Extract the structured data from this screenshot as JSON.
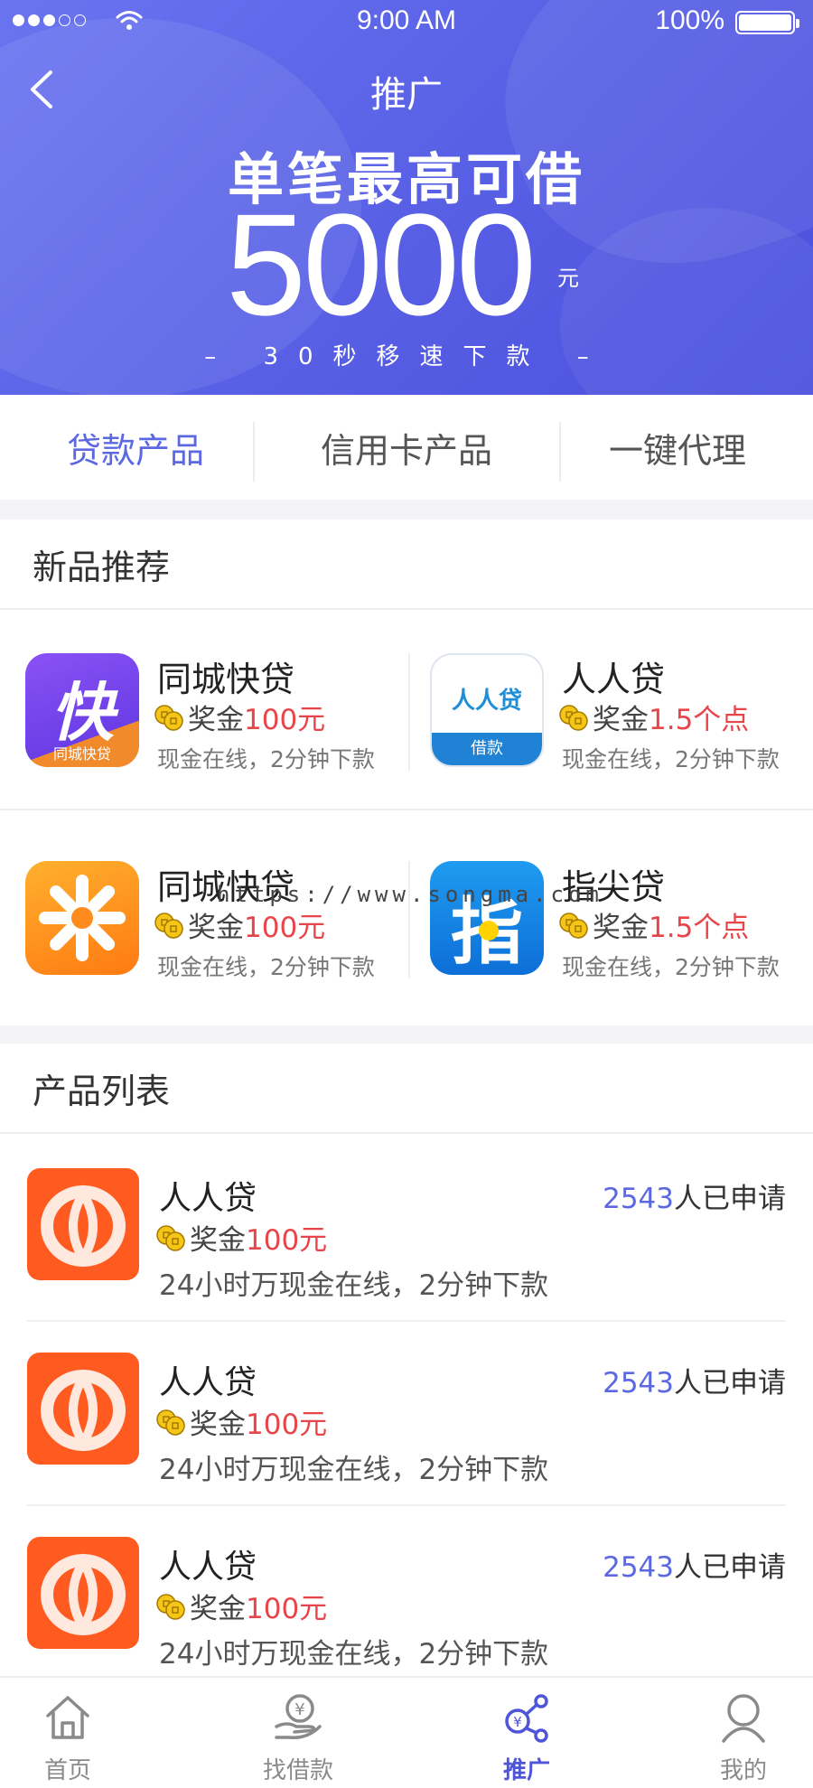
{
  "status_bar": {
    "time": "9:00 AM",
    "battery": "100%"
  },
  "nav": {
    "title": "推广"
  },
  "banner": {
    "headline": "单笔最高可借",
    "amount": "5000",
    "unit": "元",
    "subline": "– 30秒移速下款 –"
  },
  "tabs": [
    {
      "label": "贷款产品",
      "active": true
    },
    {
      "label": "信用卡产品",
      "active": false
    },
    {
      "label": "一键代理",
      "active": false
    }
  ],
  "new_products": {
    "title": "新品推荐",
    "items": [
      {
        "name": "同城快贷",
        "bonus_label": "奖金",
        "bonus_value": "100元",
        "desc": "现金在线，2分钟下款",
        "icon": "kuai-app-icon",
        "icon_text": "快",
        "icon_subtext": "同城快贷"
      },
      {
        "name": "人人贷",
        "bonus_label": "奖金",
        "bonus_value": "1.5个点",
        "desc": "现金在线，2分钟下款",
        "icon": "renrendai-app-icon",
        "icon_text": "人人贷",
        "icon_subtext": "借款"
      },
      {
        "name": "同城快贷",
        "bonus_label": "奖金",
        "bonus_value": "100元",
        "desc": "现金在线，2分钟下款",
        "icon": "star-app-icon"
      },
      {
        "name": "指尖贷",
        "bonus_label": "奖金",
        "bonus_value": "1.5个点",
        "desc": "现金在线，2分钟下款",
        "icon": "zhijian-app-icon",
        "icon_text": "指"
      }
    ]
  },
  "watermark": "https://www.songma.com",
  "product_list": {
    "title": "产品列表",
    "items": [
      {
        "name": "人人贷",
        "bonus_label": "奖金",
        "bonus_value": "100元",
        "desc": "24小时万现金在线，2分钟下款",
        "count": "2543",
        "count_suffix": "人已申请"
      },
      {
        "name": "人人贷",
        "bonus_label": "奖金",
        "bonus_value": "100元",
        "desc": "24小时万现金在线，2分钟下款",
        "count": "2543",
        "count_suffix": "人已申请"
      },
      {
        "name": "人人贷",
        "bonus_label": "奖金",
        "bonus_value": "100元",
        "desc": "24小时万现金在线，2分钟下款",
        "count": "2543",
        "count_suffix": "人已申请"
      }
    ]
  },
  "tabbar": [
    {
      "label": "首页",
      "icon": "home-icon",
      "active": false
    },
    {
      "label": "找借款",
      "icon": "loan-hand-icon",
      "active": false
    },
    {
      "label": "推广",
      "icon": "share-network-icon",
      "active": true
    },
    {
      "label": "我的",
      "icon": "user-icon",
      "active": false
    }
  ],
  "colors": {
    "accent": "#5b68e2",
    "bonus": "#e8454a",
    "banner": "#5a62e6"
  }
}
